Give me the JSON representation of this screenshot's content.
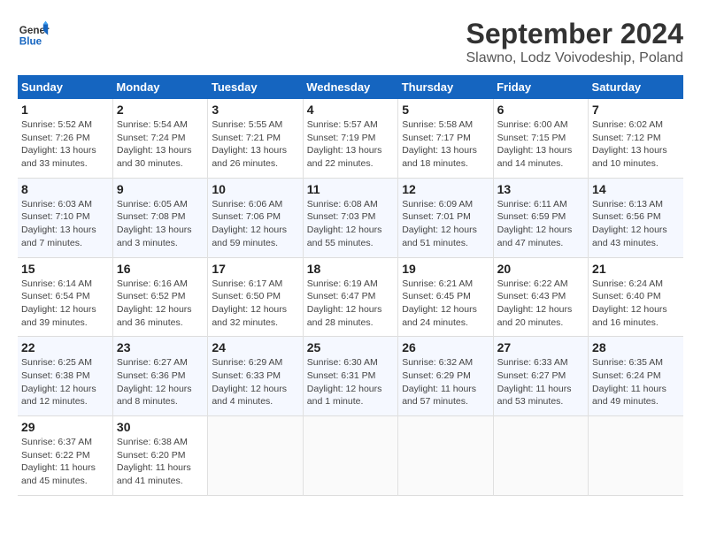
{
  "header": {
    "logo_line1": "General",
    "logo_line2": "Blue",
    "month": "September 2024",
    "location": "Slawno, Lodz Voivodeship, Poland"
  },
  "weekdays": [
    "Sunday",
    "Monday",
    "Tuesday",
    "Wednesday",
    "Thursday",
    "Friday",
    "Saturday"
  ],
  "weeks": [
    [
      {
        "day": "1",
        "info": "Sunrise: 5:52 AM\nSunset: 7:26 PM\nDaylight: 13 hours\nand 33 minutes."
      },
      {
        "day": "2",
        "info": "Sunrise: 5:54 AM\nSunset: 7:24 PM\nDaylight: 13 hours\nand 30 minutes."
      },
      {
        "day": "3",
        "info": "Sunrise: 5:55 AM\nSunset: 7:21 PM\nDaylight: 13 hours\nand 26 minutes."
      },
      {
        "day": "4",
        "info": "Sunrise: 5:57 AM\nSunset: 7:19 PM\nDaylight: 13 hours\nand 22 minutes."
      },
      {
        "day": "5",
        "info": "Sunrise: 5:58 AM\nSunset: 7:17 PM\nDaylight: 13 hours\nand 18 minutes."
      },
      {
        "day": "6",
        "info": "Sunrise: 6:00 AM\nSunset: 7:15 PM\nDaylight: 13 hours\nand 14 minutes."
      },
      {
        "day": "7",
        "info": "Sunrise: 6:02 AM\nSunset: 7:12 PM\nDaylight: 13 hours\nand 10 minutes."
      }
    ],
    [
      {
        "day": "8",
        "info": "Sunrise: 6:03 AM\nSunset: 7:10 PM\nDaylight: 13 hours\nand 7 minutes."
      },
      {
        "day": "9",
        "info": "Sunrise: 6:05 AM\nSunset: 7:08 PM\nDaylight: 13 hours\nand 3 minutes."
      },
      {
        "day": "10",
        "info": "Sunrise: 6:06 AM\nSunset: 7:06 PM\nDaylight: 12 hours\nand 59 minutes."
      },
      {
        "day": "11",
        "info": "Sunrise: 6:08 AM\nSunset: 7:03 PM\nDaylight: 12 hours\nand 55 minutes."
      },
      {
        "day": "12",
        "info": "Sunrise: 6:09 AM\nSunset: 7:01 PM\nDaylight: 12 hours\nand 51 minutes."
      },
      {
        "day": "13",
        "info": "Sunrise: 6:11 AM\nSunset: 6:59 PM\nDaylight: 12 hours\nand 47 minutes."
      },
      {
        "day": "14",
        "info": "Sunrise: 6:13 AM\nSunset: 6:56 PM\nDaylight: 12 hours\nand 43 minutes."
      }
    ],
    [
      {
        "day": "15",
        "info": "Sunrise: 6:14 AM\nSunset: 6:54 PM\nDaylight: 12 hours\nand 39 minutes."
      },
      {
        "day": "16",
        "info": "Sunrise: 6:16 AM\nSunset: 6:52 PM\nDaylight: 12 hours\nand 36 minutes."
      },
      {
        "day": "17",
        "info": "Sunrise: 6:17 AM\nSunset: 6:50 PM\nDaylight: 12 hours\nand 32 minutes."
      },
      {
        "day": "18",
        "info": "Sunrise: 6:19 AM\nSunset: 6:47 PM\nDaylight: 12 hours\nand 28 minutes."
      },
      {
        "day": "19",
        "info": "Sunrise: 6:21 AM\nSunset: 6:45 PM\nDaylight: 12 hours\nand 24 minutes."
      },
      {
        "day": "20",
        "info": "Sunrise: 6:22 AM\nSunset: 6:43 PM\nDaylight: 12 hours\nand 20 minutes."
      },
      {
        "day": "21",
        "info": "Sunrise: 6:24 AM\nSunset: 6:40 PM\nDaylight: 12 hours\nand 16 minutes."
      }
    ],
    [
      {
        "day": "22",
        "info": "Sunrise: 6:25 AM\nSunset: 6:38 PM\nDaylight: 12 hours\nand 12 minutes."
      },
      {
        "day": "23",
        "info": "Sunrise: 6:27 AM\nSunset: 6:36 PM\nDaylight: 12 hours\nand 8 minutes."
      },
      {
        "day": "24",
        "info": "Sunrise: 6:29 AM\nSunset: 6:33 PM\nDaylight: 12 hours\nand 4 minutes."
      },
      {
        "day": "25",
        "info": "Sunrise: 6:30 AM\nSunset: 6:31 PM\nDaylight: 12 hours\nand 1 minute."
      },
      {
        "day": "26",
        "info": "Sunrise: 6:32 AM\nSunset: 6:29 PM\nDaylight: 11 hours\nand 57 minutes."
      },
      {
        "day": "27",
        "info": "Sunrise: 6:33 AM\nSunset: 6:27 PM\nDaylight: 11 hours\nand 53 minutes."
      },
      {
        "day": "28",
        "info": "Sunrise: 6:35 AM\nSunset: 6:24 PM\nDaylight: 11 hours\nand 49 minutes."
      }
    ],
    [
      {
        "day": "29",
        "info": "Sunrise: 6:37 AM\nSunset: 6:22 PM\nDaylight: 11 hours\nand 45 minutes."
      },
      {
        "day": "30",
        "info": "Sunrise: 6:38 AM\nSunset: 6:20 PM\nDaylight: 11 hours\nand 41 minutes."
      },
      {
        "day": "",
        "info": ""
      },
      {
        "day": "",
        "info": ""
      },
      {
        "day": "",
        "info": ""
      },
      {
        "day": "",
        "info": ""
      },
      {
        "day": "",
        "info": ""
      }
    ]
  ]
}
